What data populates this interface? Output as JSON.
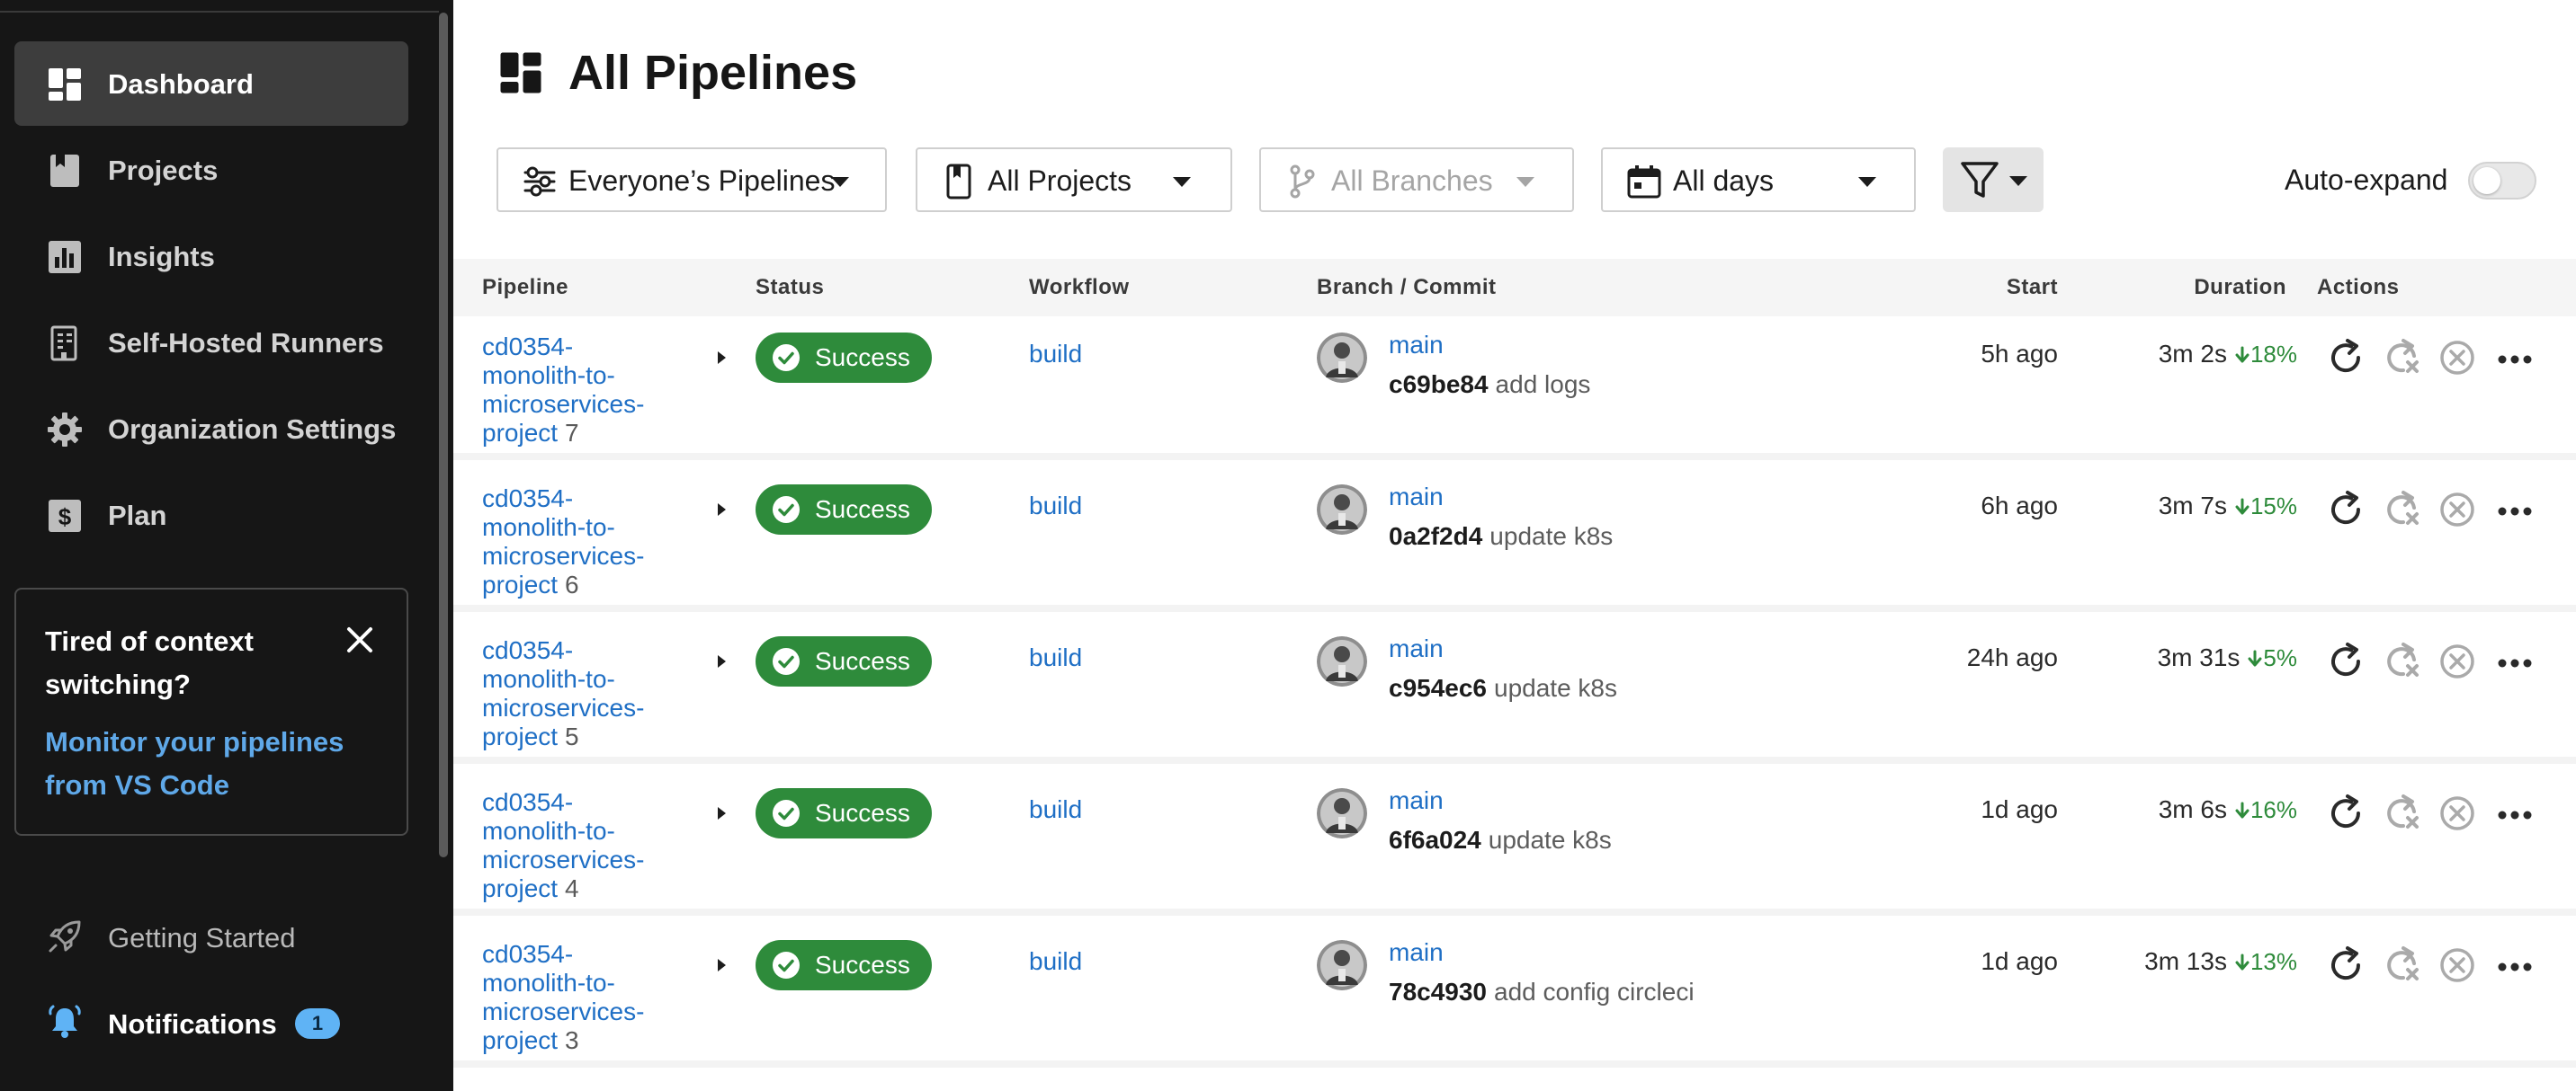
{
  "sidebar": {
    "items": [
      {
        "label": "Dashboard",
        "icon": "dashboard-icon",
        "active": true
      },
      {
        "label": "Projects",
        "icon": "projects-icon"
      },
      {
        "label": "Insights",
        "icon": "insights-icon"
      },
      {
        "label": "Self-Hosted Runners",
        "icon": "runners-icon"
      },
      {
        "label": "Organization Settings",
        "icon": "gear-icon"
      },
      {
        "label": "Plan",
        "icon": "plan-icon"
      }
    ],
    "promo": {
      "title": "Tired of context switching?",
      "link": "Monitor your pipelines from VS Code"
    },
    "getting_started": "Getting Started",
    "notifications": {
      "label": "Notifications",
      "count": "1"
    }
  },
  "header": {
    "title": "All Pipelines"
  },
  "filters": {
    "pipelines": "Everyone’s Pipelines",
    "projects": "All Projects",
    "branches": "All Branches",
    "days": "All days",
    "auto_expand": "Auto-expand"
  },
  "table": {
    "columns": {
      "pipeline": "Pipeline",
      "status": "Status",
      "workflow": "Workflow",
      "branch_commit": "Branch / Commit",
      "start": "Start",
      "duration": "Duration",
      "actions": "Actions"
    },
    "rows": [
      {
        "project": "cd0354-monolith-to-microservices-project",
        "number": "7",
        "status": "Success",
        "workflow": "build",
        "branch": "main",
        "sha": "c69be84",
        "message": "add logs",
        "start": "5h ago",
        "duration": "3m 2s",
        "delta": "18%"
      },
      {
        "project": "cd0354-monolith-to-microservices-project",
        "number": "6",
        "status": "Success",
        "workflow": "build",
        "branch": "main",
        "sha": "0a2f2d4",
        "message": "update k8s",
        "start": "6h ago",
        "duration": "3m 7s",
        "delta": "15%"
      },
      {
        "project": "cd0354-monolith-to-microservices-project",
        "number": "5",
        "status": "Success",
        "workflow": "build",
        "branch": "main",
        "sha": "c954ec6",
        "message": "update k8s",
        "start": "24h ago",
        "duration": "3m 31s",
        "delta": "5%"
      },
      {
        "project": "cd0354-monolith-to-microservices-project",
        "number": "4",
        "status": "Success",
        "workflow": "build",
        "branch": "main",
        "sha": "6f6a024",
        "message": "update k8s",
        "start": "1d ago",
        "duration": "3m 6s",
        "delta": "16%"
      },
      {
        "project": "cd0354-monolith-to-microservices-project",
        "number": "3",
        "status": "Success",
        "workflow": "build",
        "branch": "main",
        "sha": "78c4930",
        "message": "add config circleci",
        "start": "1d ago",
        "duration": "3m 13s",
        "delta": "13%"
      }
    ]
  },
  "colors": {
    "sidebar_bg": "#161616",
    "active_bg": "#3d3d3d",
    "link": "#1f6fc5",
    "success": "#2e8b3b",
    "badge": "#5fb3f5"
  }
}
